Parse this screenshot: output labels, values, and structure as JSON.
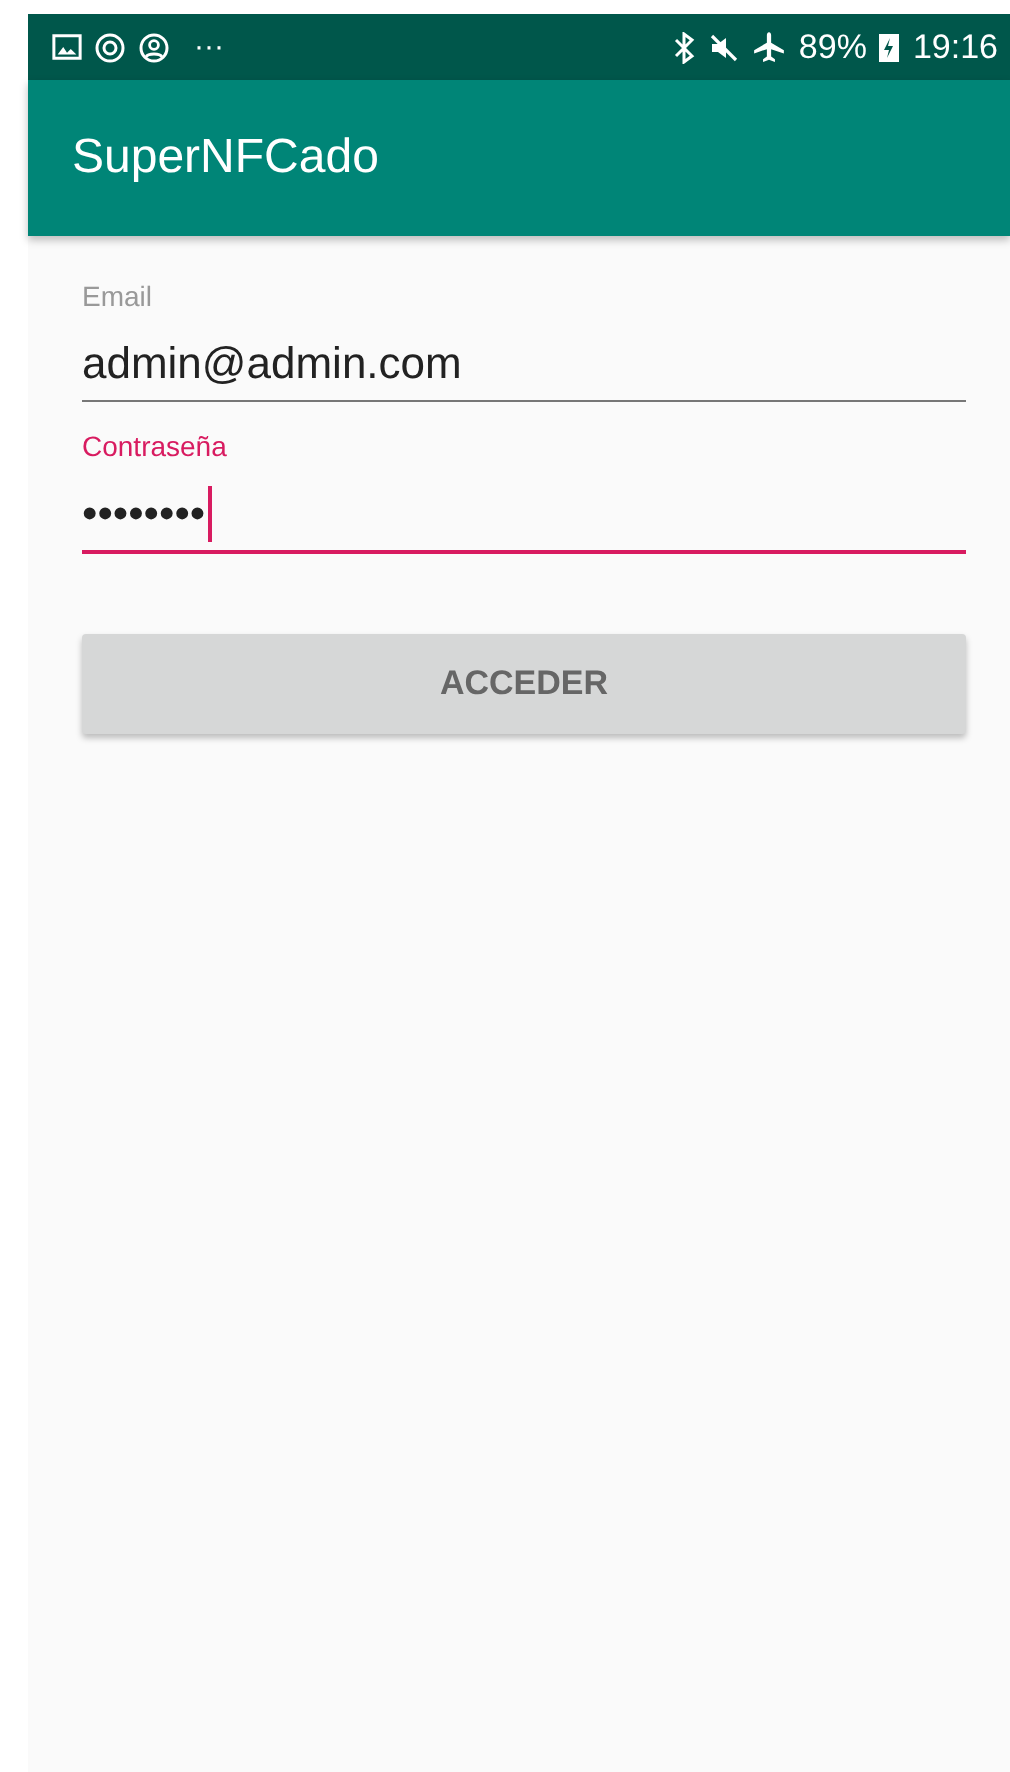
{
  "status_bar": {
    "overflow": "···",
    "battery": "89%",
    "time": "19:16"
  },
  "app_bar": {
    "title": "SuperNFCado"
  },
  "fields": [
    {
      "label": "Email",
      "value": "admin@admin.com",
      "focused": false
    },
    {
      "label": "Contraseña",
      "value": "••••••••",
      "focused": true
    }
  ],
  "button": {
    "label": "ACCEDER"
  }
}
